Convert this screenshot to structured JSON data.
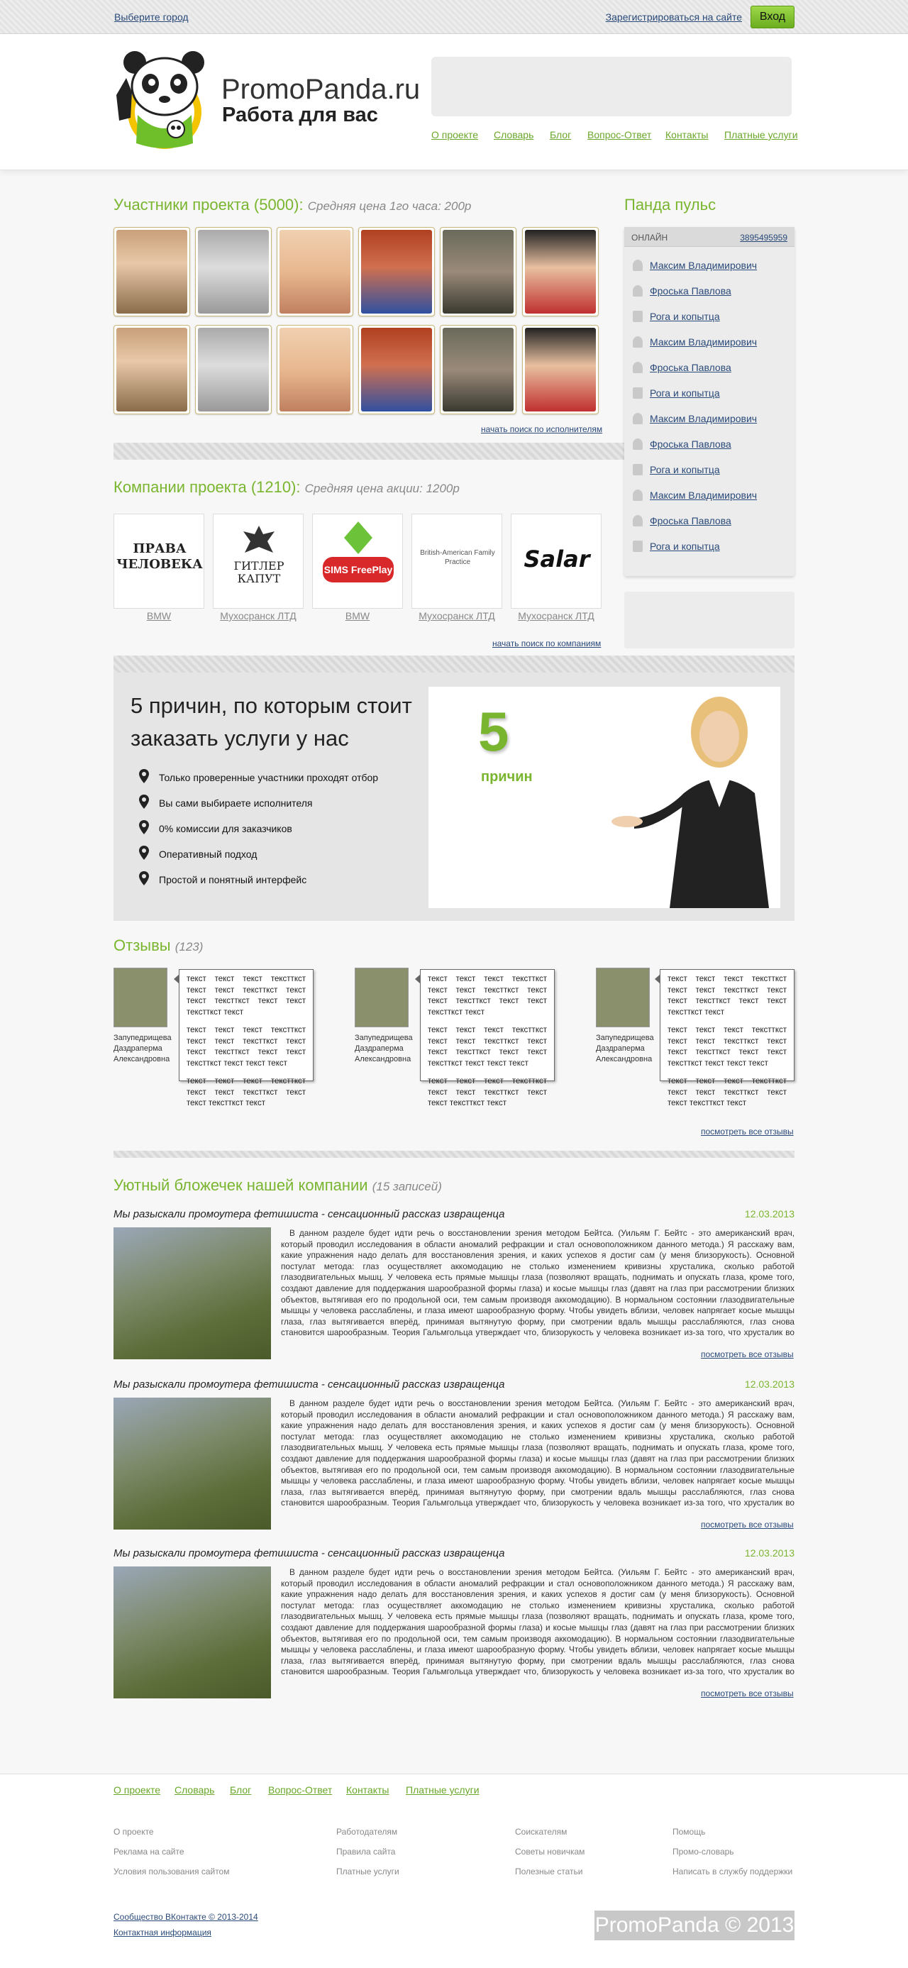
{
  "topbar": {
    "region_link": "Выберите город",
    "register_link": "Зарегистрироваться на сайте",
    "login_button": "Вход"
  },
  "header": {
    "logo_title": "PromoPanda.ru",
    "logo_subtitle": "Работа для вас",
    "nav": [
      "О проекте",
      "Словарь",
      "Блог",
      "Вопрос-Ответ",
      "Контакты",
      "Платные услуги"
    ]
  },
  "participants": {
    "heading": "Участники проекта (5000):",
    "price_note": "Средняя цена 1го часа: 200р",
    "search_link": "начать поиск по исполнителям"
  },
  "companies": {
    "heading": "Компании проекта (1210):",
    "price_note": "Средняя цена акции: 1200р",
    "logos": [
      "ПРАВА ЧЕЛОВЕКА",
      "ГИТЛЕР КАПУТ",
      "SIMS FreePlay",
      "British-American Family Practice",
      "Salar"
    ],
    "labels": [
      "BMW",
      "Мухосранск ЛТД",
      "BMW",
      "Мухосранск ЛТД",
      "Мухосранск ЛТД"
    ],
    "search_link": "начать поиск по компаниям"
  },
  "pulse": {
    "heading": "Панда пульс",
    "online_label": "ОНЛАЙН",
    "online_number": "3895495959",
    "items": [
      "Максим Владимирович",
      "Фроська Павлова",
      "Рога и копытца",
      "Максим Владимирович",
      "Фроська Павлова",
      "Рога и копытца",
      "Максим Владимирович",
      "Фроська Павлова",
      "Рога и копытца",
      "Максим Владимирович",
      "Фроська Павлова",
      "Рога и копытца"
    ]
  },
  "reasons": {
    "title": "5 причин, по которым стоит заказать услуги у нас",
    "items": [
      "Только проверенные участники проходят отбор",
      "Вы сами выбираете исполнителя",
      "0% комиссии для заказчиков",
      "Оперативный подход",
      "Простой и понятный интерфейс"
    ],
    "badge_number": "5",
    "badge_word": "причин"
  },
  "reviews": {
    "heading": "Отзывы",
    "count": "(123)",
    "author": "Запупедрищева Даздраперма Александровна",
    "text_a": "текст текст текст текстткст текст текст текстткст текст текст текстткст текст текст текстткст текст",
    "text_b": "текст текст текст текстткст текст текст текстткст текст текст текстткст текст текст текстткст текст текст текст",
    "text_c": "текст текст текст текстткст текст текст текстткст текст текст текстткст текст",
    "all_link": "посмотреть все отзывы"
  },
  "blog": {
    "heading": "Уютный бложечек нашей компании",
    "count": "(15 записей)",
    "post_title": "Мы разыскали промоутера фетишиста - сенсационный рассказ извращенца",
    "post_date": "12.03.2013",
    "post_text": "В данном разделе будет идти речь о восстановлении зрения методом Бейтса. (Уильям Г. Бейтс - это американский врач, который проводил исследования в области аномалий рефракции и стал основоположником данного метода.) Я расскажу вам, какие упражнения надо делать для восстановления зрения, и каких успехов я достиг сам (у меня близорукость). Основной постулат метода: глаз осуществляет аккомодацию не столько изменением кривизны хрусталика, сколько работой глазодвигательных мышц. У человека есть прямые мышцы глаза (позволяют вращать, поднимать и опускать глаза, кроме того, создают давление для поддержания шарообразной формы глаза) и косые мышцы глаз (давят на глаз при рассмотрении близких объектов, вытягивая его по продольной оси, тем самым производя аккомодацию). В нормальном состоянии глазодвигательные мышцы у человека расслаблены, и глаза имеют шарообразную форму. Чтобы увидеть вблизи, человек напрягает косые мышцы глаза, глаз вытягивается вперёд, принимая вытянутую форму, при смотрении вдаль мышцы расслабляются, глаз снова становится шарообразным. Теория Гальмгольца утверждает что, близорукость у человека возникает из-за того, что хрусталик во время находится в выпуклом состоянии, а дальнозоркость - из-за того, что хрусталик не может стать выпуклым. Бейтс же утверждает,",
    "all_link": "посмотреть все отзывы"
  },
  "footer": {
    "nav": [
      "О проекте",
      "Словарь",
      "Блог",
      "Вопрос-Ответ",
      "Контакты",
      "Платные услуги"
    ],
    "col1": [
      "О проекте",
      "Реклама на сайте",
      "Условия пользования сайтом"
    ],
    "col2": [
      "Работодателям",
      "Правила сайта",
      "Платные услуги"
    ],
    "col3": [
      "Соискателям",
      "Советы новичкам",
      "Полезные статьи"
    ],
    "col4": [
      "Помощь",
      "Промо-словарь",
      "Написать в службу поддержки"
    ],
    "copyright": "Сообщество ВКонтакте © 2013-2014",
    "contacts": "Контактная информация",
    "brand": "PromoPanda © 2013"
  },
  "colors": {
    "accent_green": "#7ab530",
    "link_blue": "#2a4a7a",
    "login_green": "#8cc63f"
  }
}
